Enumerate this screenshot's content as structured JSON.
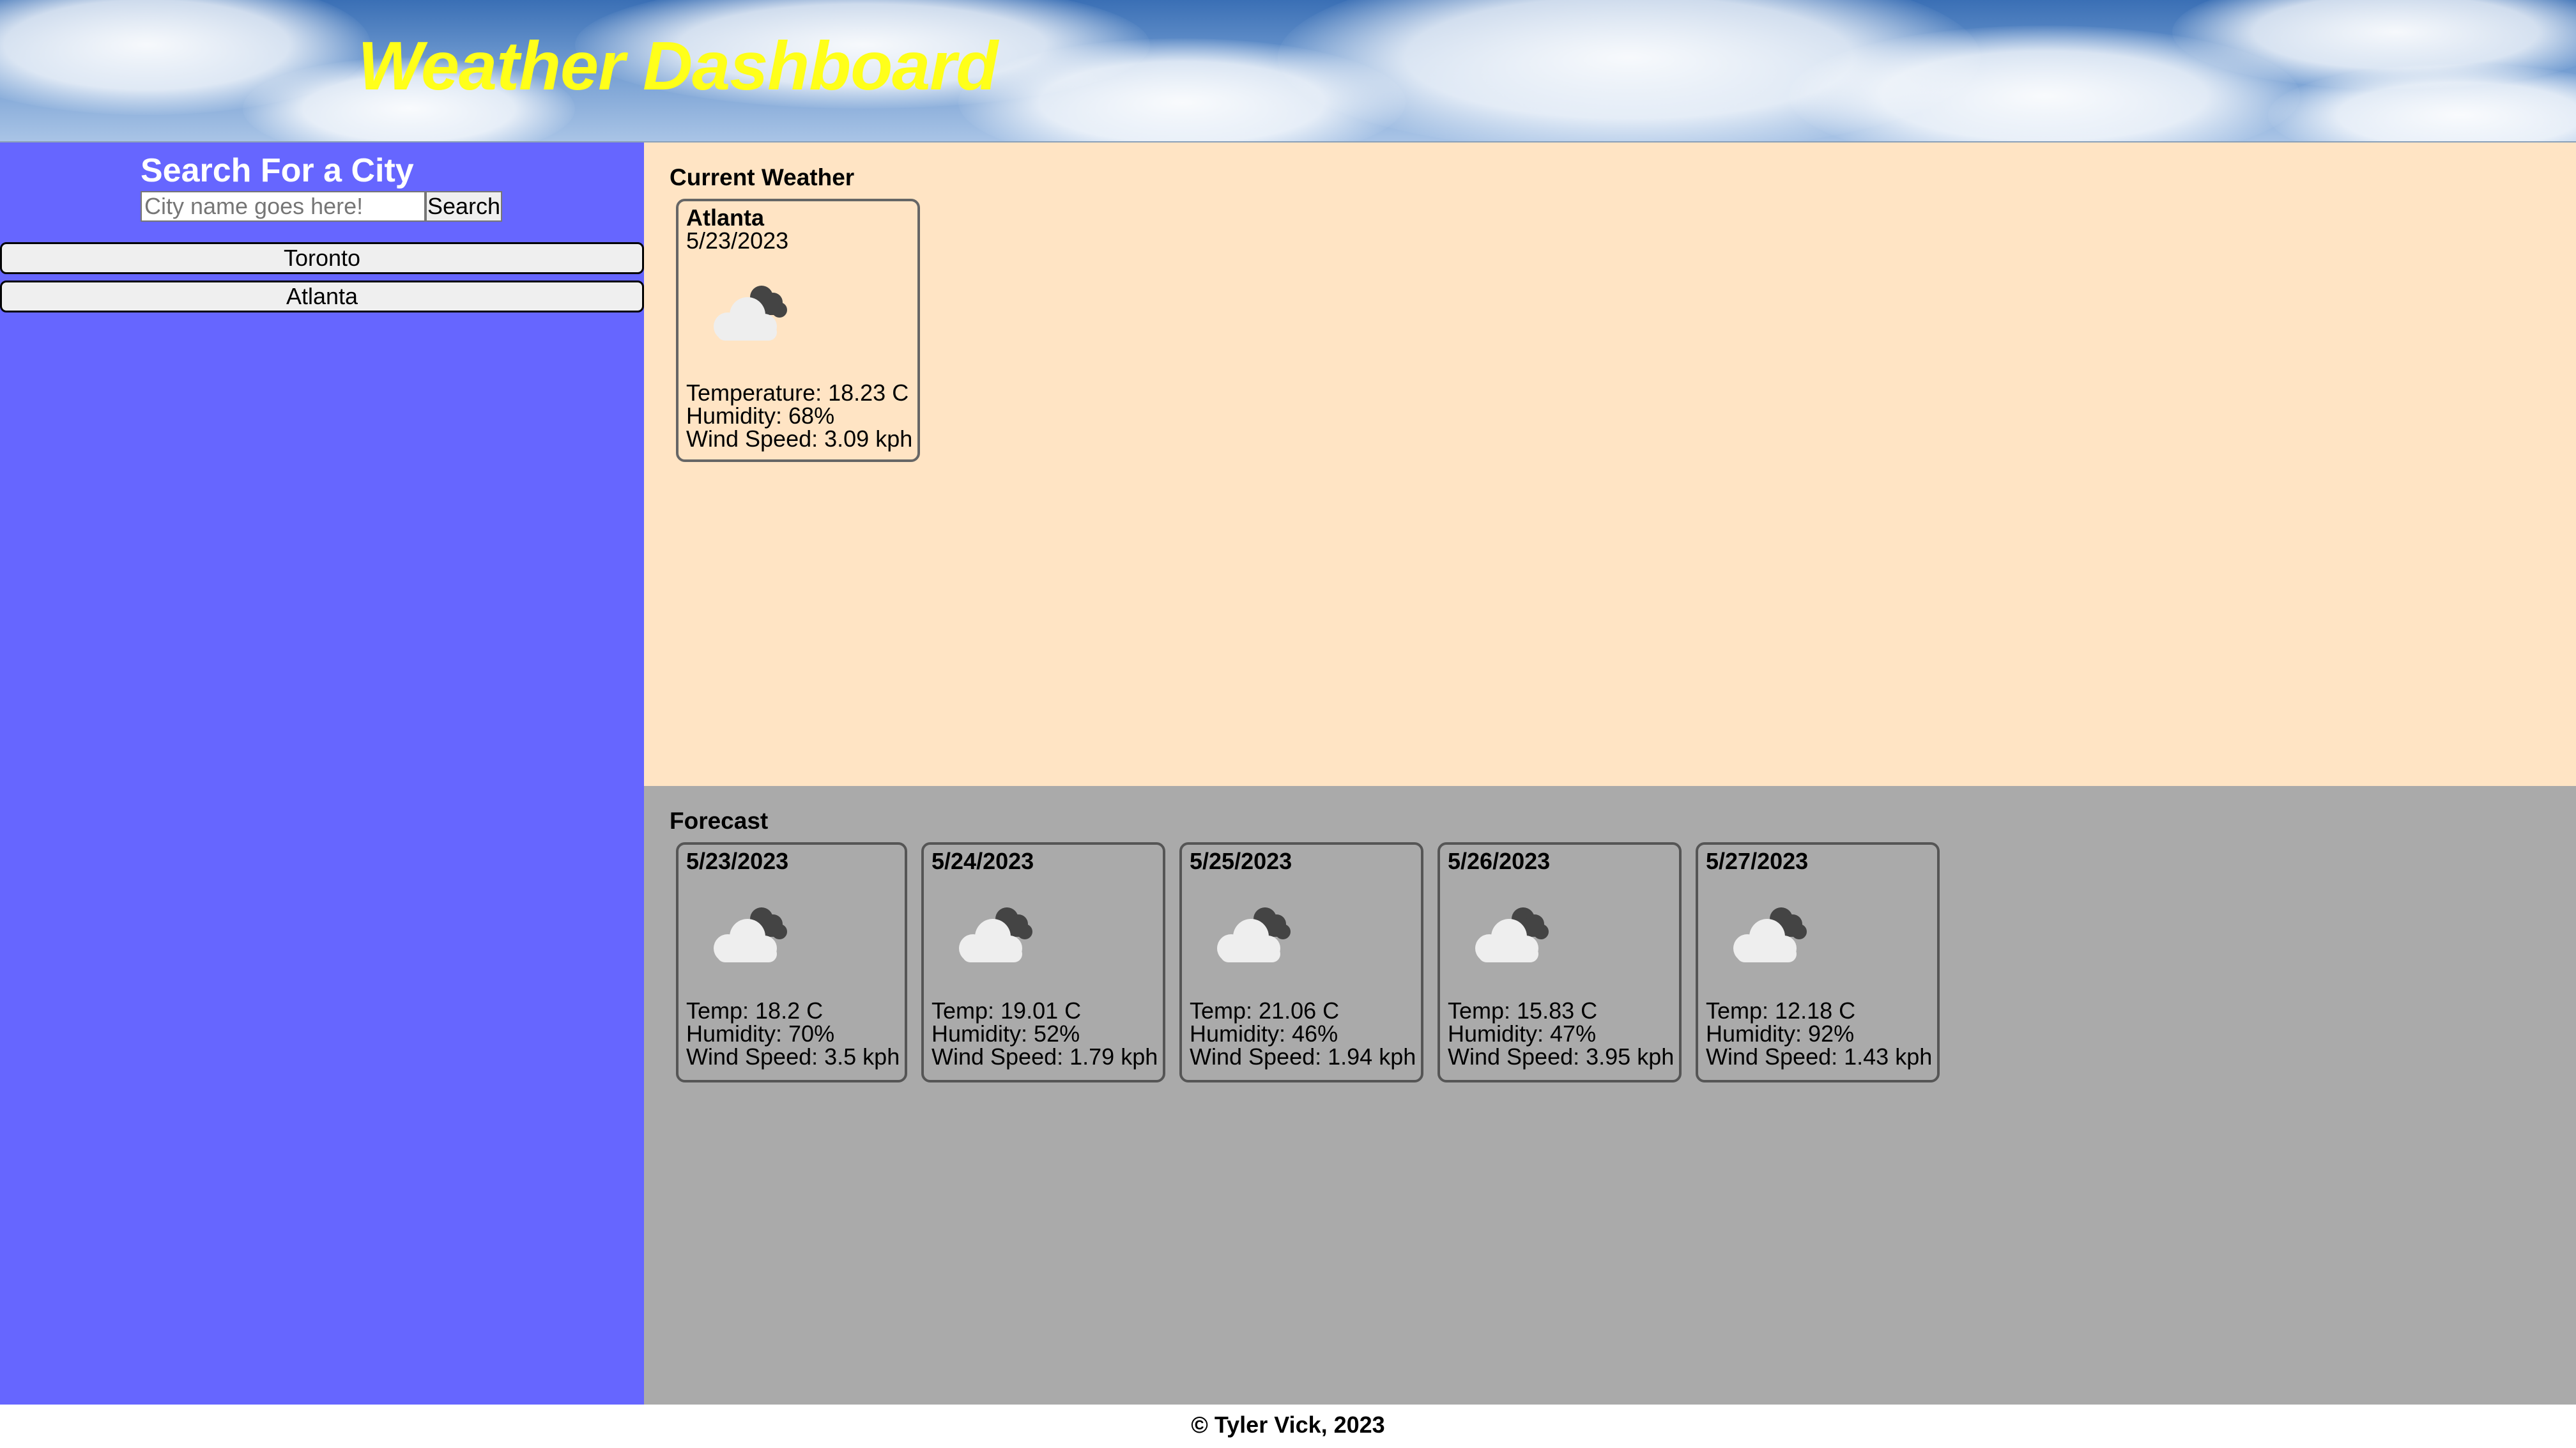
{
  "header": {
    "title": "Weather Dashboard"
  },
  "sidebar": {
    "heading": "Search For a City",
    "search_placeholder": "City name goes here!",
    "search_button": "Search",
    "history": [
      "Toronto",
      "Atlanta"
    ]
  },
  "current": {
    "section_title": "Current Weather",
    "city": "Atlanta",
    "date": "5/23/2023",
    "icon": "cloudy-icon",
    "temperature": "Temperature: 18.23 C",
    "humidity": "Humidity: 68%",
    "wind": "Wind Speed: 3.09 kph"
  },
  "forecast": {
    "section_title": "Forecast",
    "days": [
      {
        "date": "5/23/2023",
        "icon": "cloudy-icon",
        "temp": "Temp: 18.2 C",
        "humidity": "Humidity: 70%",
        "wind": "Wind Speed: 3.5 kph"
      },
      {
        "date": "5/24/2023",
        "icon": "cloudy-icon",
        "temp": "Temp: 19.01 C",
        "humidity": "Humidity: 52%",
        "wind": "Wind Speed: 1.79 kph"
      },
      {
        "date": "5/25/2023",
        "icon": "cloudy-icon",
        "temp": "Temp: 21.06 C",
        "humidity": "Humidity: 46%",
        "wind": "Wind Speed: 1.94 kph"
      },
      {
        "date": "5/26/2023",
        "icon": "cloudy-icon",
        "temp": "Temp: 15.83 C",
        "humidity": "Humidity: 47%",
        "wind": "Wind Speed: 3.95 kph"
      },
      {
        "date": "5/27/2023",
        "icon": "cloudy-icon",
        "temp": "Temp: 12.18 C",
        "humidity": "Humidity: 92%",
        "wind": "Wind Speed: 1.43 kph"
      }
    ]
  },
  "footer": {
    "text": "© Tyler Vick, 2023"
  },
  "colors": {
    "title_yellow": "#ffff1a",
    "sidebar_bg": "#6666ff",
    "current_bg": "#ffe4c4",
    "forecast_bg": "#aaaaaa"
  }
}
